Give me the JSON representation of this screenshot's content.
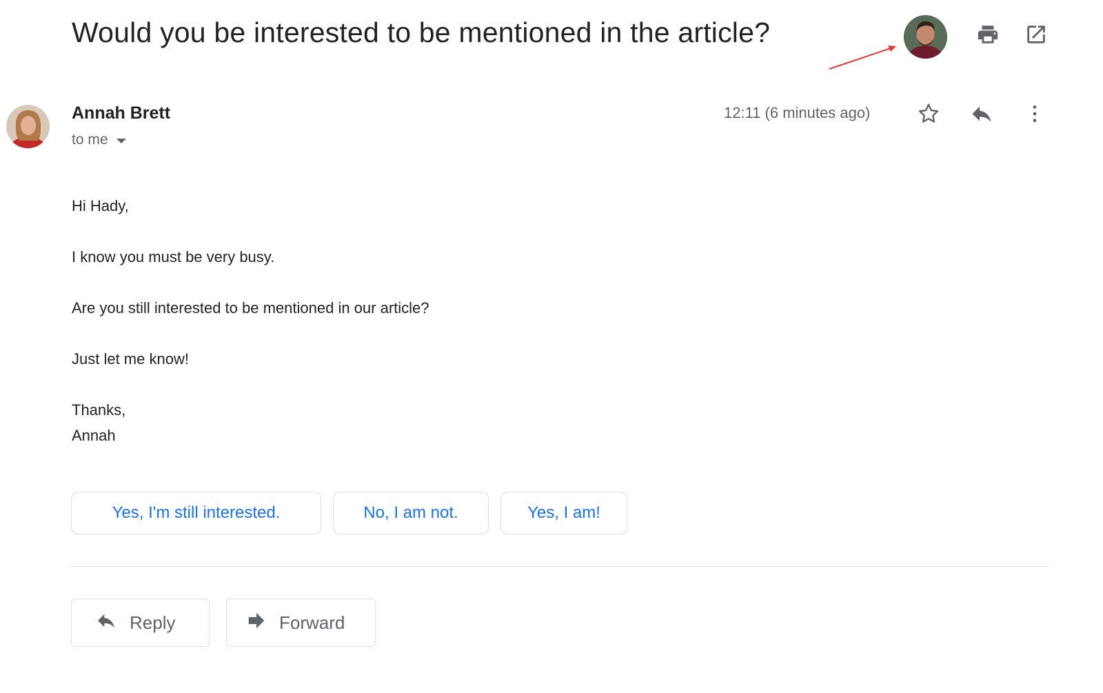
{
  "email": {
    "subject": "Would you be interested to be mentioned in the article?",
    "sender_name": "Annah Brett",
    "recipient": "to me",
    "timestamp": "12:11 (6 minutes ago)",
    "body": {
      "greeting": "Hi Hady,",
      "line1": "I know you must be very busy.",
      "line2": "Are you still interested to be mentioned in our article?",
      "line3": "Just let me know!",
      "signoff": "Thanks,",
      "signature": "Annah"
    }
  },
  "smart_replies": [
    {
      "label": "Yes, I'm still interested."
    },
    {
      "label": "No, I am not."
    },
    {
      "label": "Yes, I am!"
    }
  ],
  "actions": {
    "reply_label": "Reply",
    "forward_label": "Forward"
  },
  "icons": {
    "print": "print-icon",
    "popout": "open-in-new-window-icon",
    "star": "star-icon",
    "reply": "reply-icon",
    "more": "more-vertical-icon",
    "forward": "forward-icon",
    "dropdown": "chevron-down-icon"
  },
  "colors": {
    "link_blue": "#1a73e8",
    "icon_gray": "#5f6368",
    "annotation_red": "#e53935"
  }
}
